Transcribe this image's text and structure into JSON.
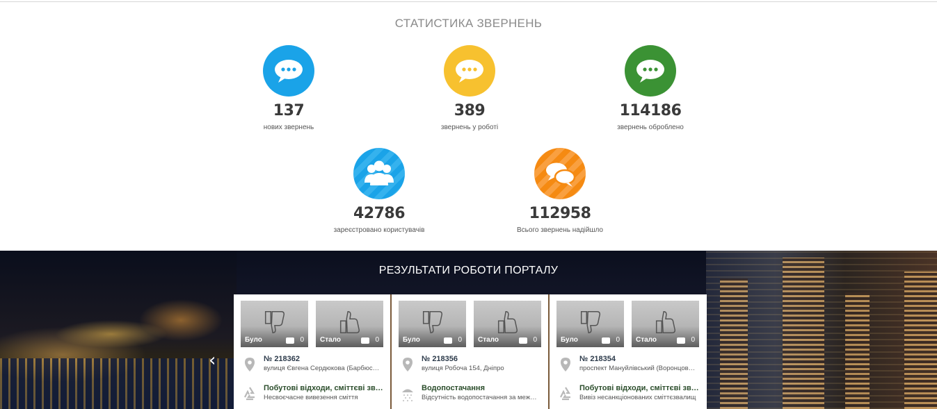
{
  "stats": {
    "title": "СТАТИСТИКА ЗВЕРНЕНЬ",
    "items": [
      {
        "value": "137",
        "label": "нових звернень",
        "color": "#1aa3e8",
        "icon": "chat-bubble-icon"
      },
      {
        "value": "389",
        "label": "звернень у роботі",
        "color": "#f7c12f",
        "icon": "chat-bubble-icon"
      },
      {
        "value": "114186",
        "label": "звернень оброблено",
        "color": "#3b9234",
        "icon": "chat-bubble-icon"
      },
      {
        "value": "42786",
        "label": "зареєстровано користувачів",
        "color": "#1aa3e8",
        "icon": "users-icon"
      },
      {
        "value": "112958",
        "label": "Всього звернень надійшло",
        "color": "#f58a12",
        "icon": "two-chat-bubbles-icon"
      }
    ]
  },
  "results": {
    "title": "РЕЗУЛЬТАТИ РОБОТИ ПОРТАЛУ",
    "before_label": "Було",
    "after_label": "Стало",
    "cards": [
      {
        "before_count": "0",
        "after_count": "0",
        "number": "№ 218362",
        "address": "вулиця Євгена Сердюкова (Барбюса) 62,...",
        "category": "Побутові відходи, сміттєві звал...",
        "description": "Несвоєчасне вивезення сміття",
        "category_icon": "recycle-icon"
      },
      {
        "before_count": "0",
        "after_count": "0",
        "number": "№ 218356",
        "address": "вулиця Робоча 154, Дніпро",
        "category": "Водопостачання",
        "description": "Відсутність водопостачання за межами б...",
        "category_icon": "shower-icon"
      },
      {
        "before_count": "0",
        "after_count": "0",
        "number": "№ 218354",
        "address": "проспект Мануйлівський (Воронцова) 5...",
        "category": "Побутові відходи, сміттєві звал...",
        "description": "Вивіз несанкціонованих сміттєзвалищ",
        "category_icon": "recycle-icon"
      }
    ]
  }
}
